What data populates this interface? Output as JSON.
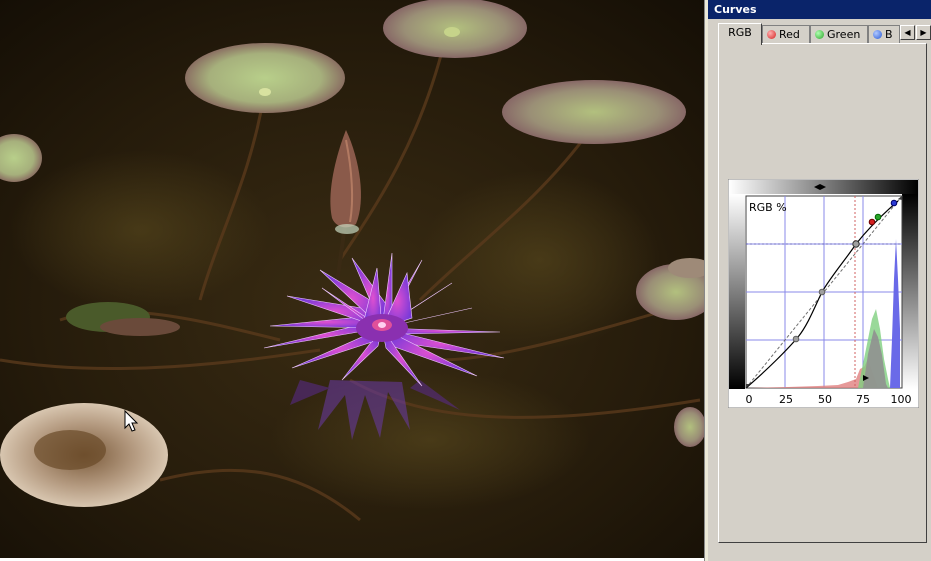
{
  "panel": {
    "title": "Curves",
    "tabs": [
      {
        "label": "RGB",
        "active": true
      },
      {
        "label": "Red",
        "dot_color": "#d42020"
      },
      {
        "label": "Green",
        "dot_color": "#2aa52a"
      },
      {
        "label": "B",
        "dot_color": "#2a5ad4"
      }
    ]
  },
  "curve": {
    "label": "RGB %",
    "x_ticks": [
      "0",
      "25",
      "50",
      "75",
      "100"
    ]
  },
  "colors": {
    "title_bar": "#0a246a",
    "panel_bg": "#d4d0c8",
    "grid": "#8888e8"
  }
}
